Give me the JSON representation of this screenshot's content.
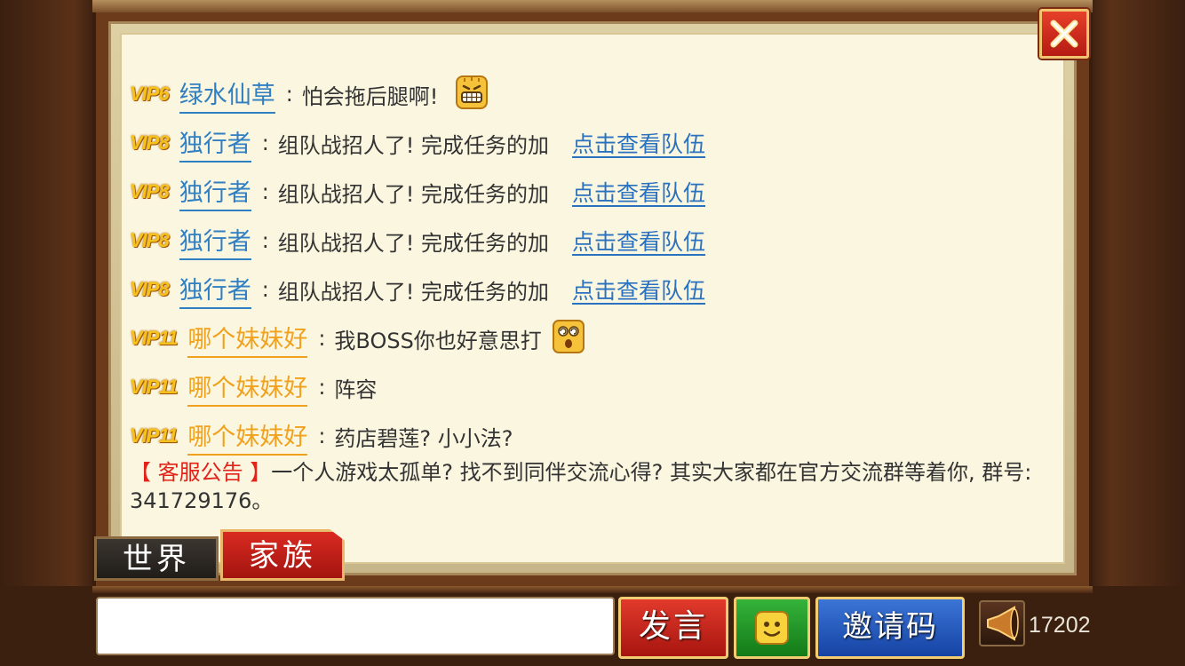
{
  "messages": [
    {
      "vip": "VIP6",
      "user": "绿水仙草",
      "color": "blue",
      "text": "怕会拖后腿啊!",
      "emoji": "grin-icon"
    },
    {
      "vip": "VIP8",
      "user": "独行者",
      "color": "blue",
      "text": "组队战招人了! 完成任务的加",
      "link": "点击查看队伍"
    },
    {
      "vip": "VIP8",
      "user": "独行者",
      "color": "blue",
      "text": "组队战招人了! 完成任务的加",
      "link": "点击查看队伍"
    },
    {
      "vip": "VIP8",
      "user": "独行者",
      "color": "blue",
      "text": "组队战招人了! 完成任务的加",
      "link": "点击查看队伍"
    },
    {
      "vip": "VIP8",
      "user": "独行者",
      "color": "blue",
      "text": "组队战招人了! 完成任务的加",
      "link": "点击查看队伍"
    },
    {
      "vip": "VIP11",
      "user": "哪个妹妹好",
      "color": "orange",
      "text": "我BOSS你也好意思打",
      "emoji": "dizzy-icon"
    },
    {
      "vip": "VIP11",
      "user": "哪个妹妹好",
      "color": "orange",
      "text": "阵容"
    },
    {
      "vip": "VIP11",
      "user": "哪个妹妹好",
      "color": "orange",
      "text": "药店碧莲? 小小法?"
    }
  ],
  "colon": ":",
  "notice": {
    "tag": "【 客服公告 】",
    "text": "一个人游戏太孤单? 找不到同伴交流心得? 其实大家都在官方交流群等着你, 群号: 341729176。"
  },
  "tabs": {
    "world": "世界",
    "family": "家族"
  },
  "buttons": {
    "send": "发言",
    "invite": "邀请码"
  },
  "horn_count": "17202",
  "colors": {
    "user_blue": "#2f7fc2",
    "user_orange": "#f0a21e",
    "notice_tag": "#e2231a"
  }
}
